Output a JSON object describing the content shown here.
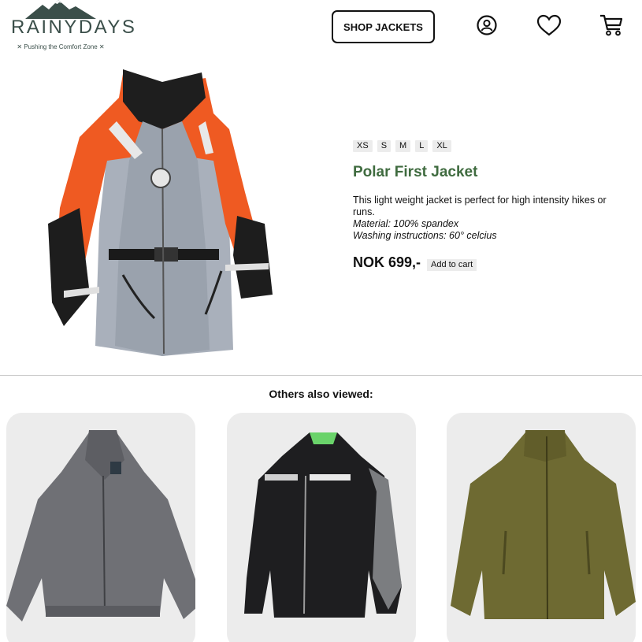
{
  "header": {
    "logo_text": "RAINYDAYS",
    "logo_tagline": "✕ Pushing the Comfort Zone ✕",
    "shop_button": "SHOP JACKETS",
    "icons": [
      "account-icon",
      "heart-icon",
      "cart-icon"
    ]
  },
  "product": {
    "sizes": [
      "XS",
      "S",
      "M",
      "L",
      "XL"
    ],
    "title": "Polar First Jacket",
    "description": "This light weight jacket is perfect for high intensity hikes or runs.",
    "material": "Material: 100% spandex",
    "washing": "Washing instructions: 60° celcius",
    "price": "NOK 699,-",
    "add_to_cart": "Add to cart",
    "colors": {
      "title": "#3f6b3f",
      "orange": "#ef5a22",
      "grey": "#a9b0bb"
    }
  },
  "others": {
    "heading": "Others also viewed:",
    "items": [
      {
        "image": "grey-bomber-jacket"
      },
      {
        "image": "black-scott-motorcycle-jacket"
      },
      {
        "image": "olive-fleece-jacket"
      }
    ]
  }
}
